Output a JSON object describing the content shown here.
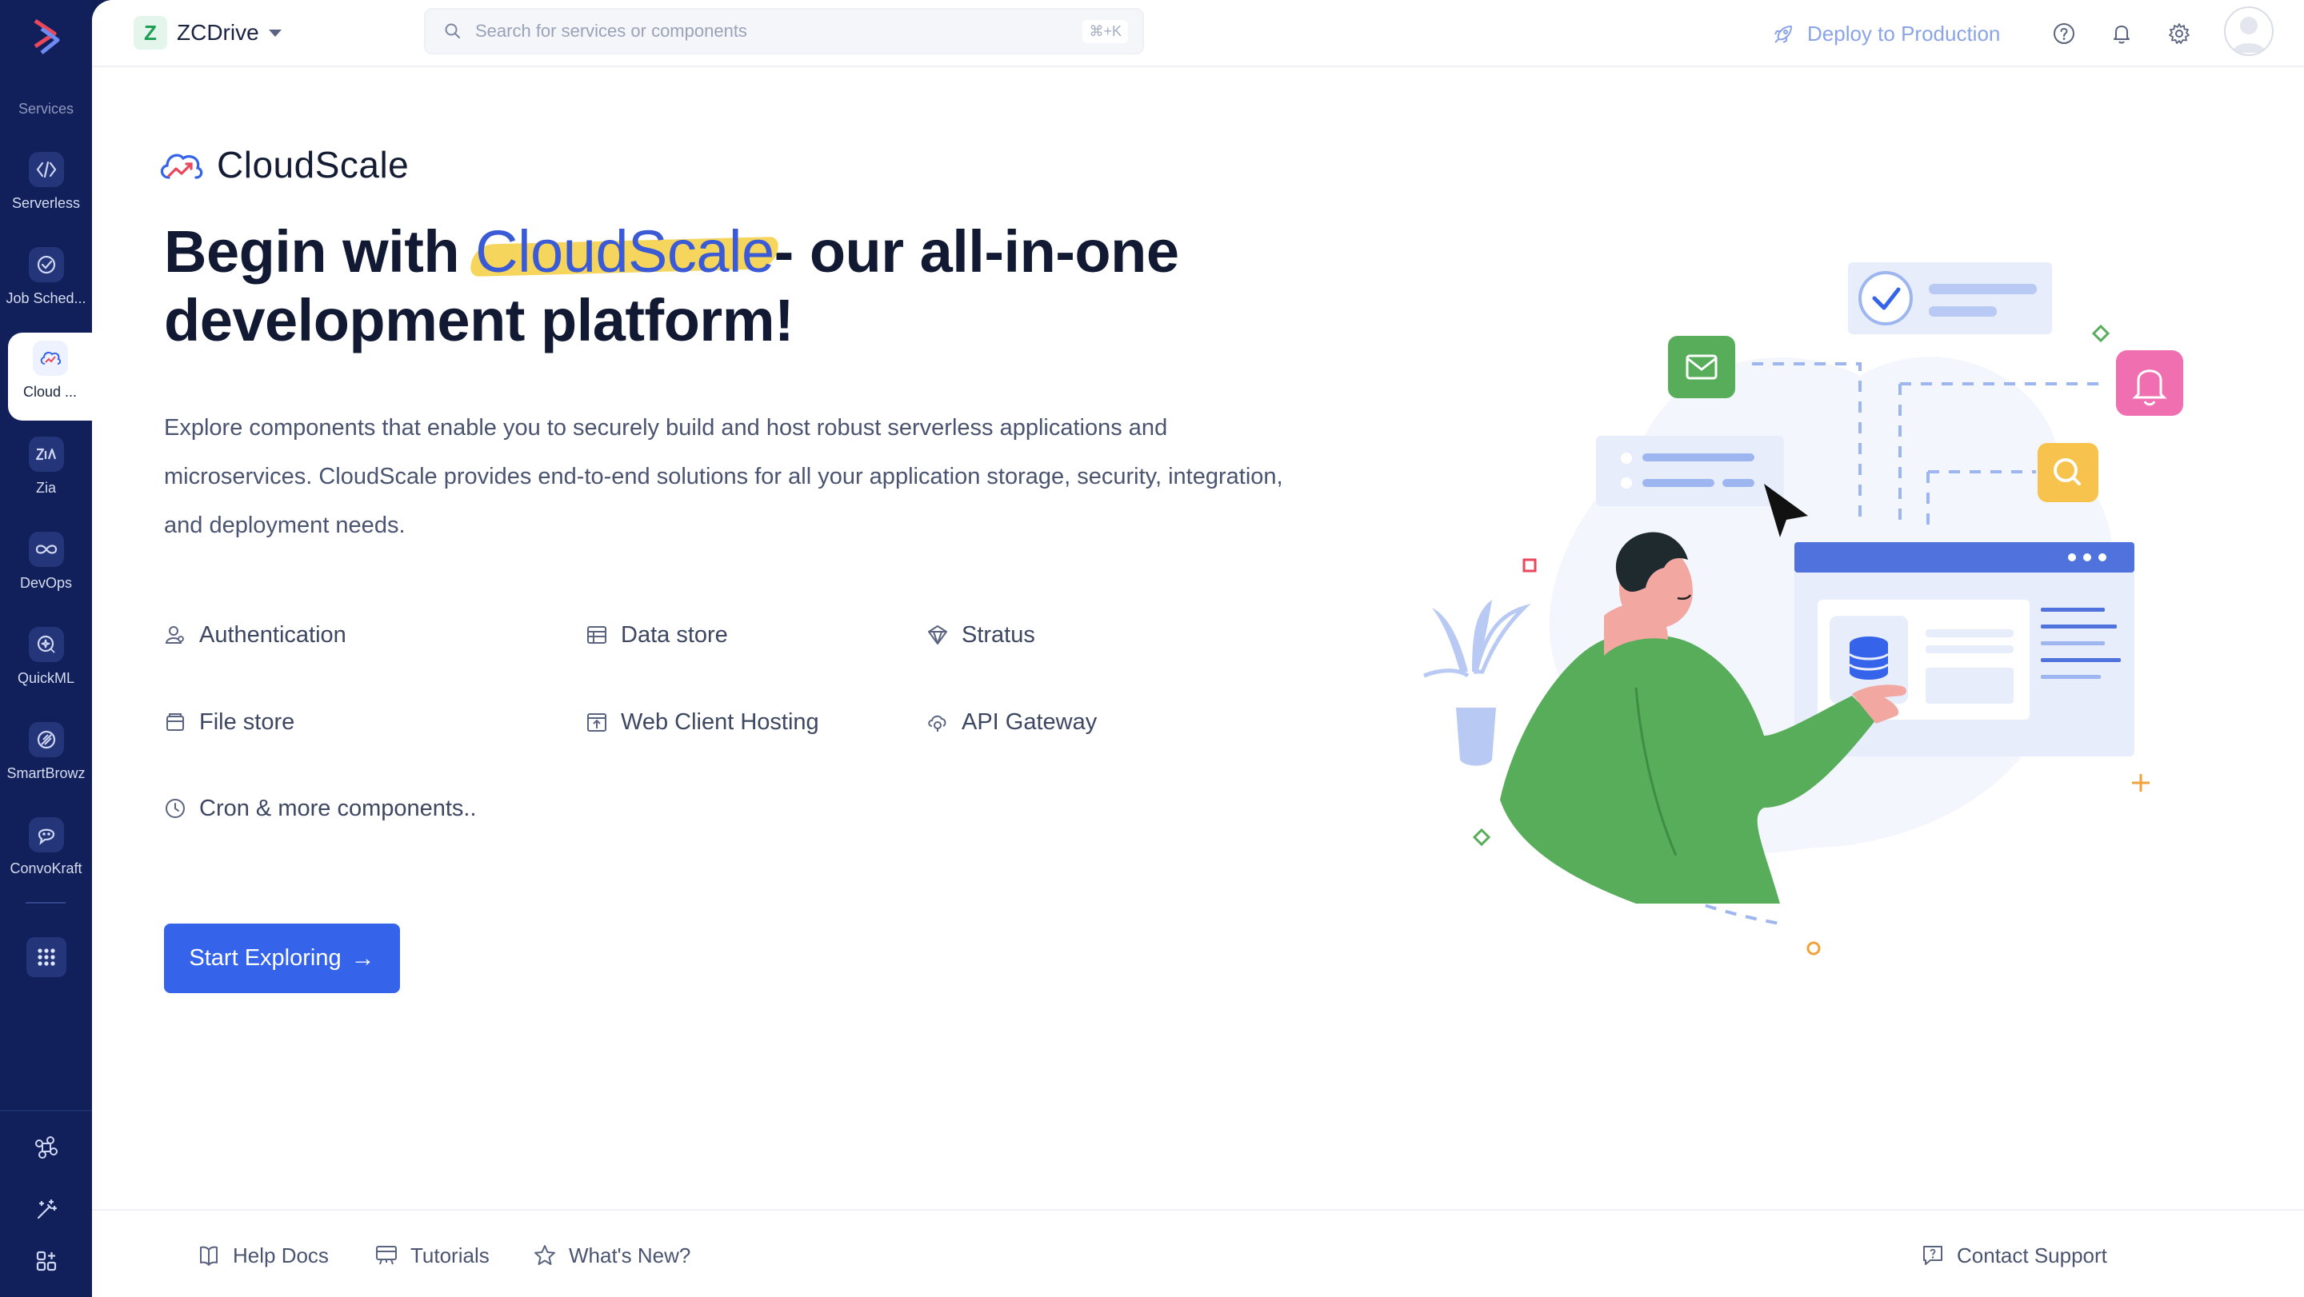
{
  "sidebar": {
    "section_label": "Services",
    "items": [
      {
        "label": "Serverless",
        "icon": "serverless-icon"
      },
      {
        "label": "Job Sched...",
        "icon": "job-scheduler-icon"
      },
      {
        "label": "Cloud ...",
        "icon": "cloudscale-icon",
        "active": true
      },
      {
        "label": "Zia",
        "icon": "zia-icon"
      },
      {
        "label": "DevOps",
        "icon": "devops-icon"
      },
      {
        "label": "QuickML",
        "icon": "quickml-icon"
      },
      {
        "label": "SmartBrowz",
        "icon": "smartbrowz-icon"
      },
      {
        "label": "ConvoKraft",
        "icon": "convokraft-icon"
      }
    ]
  },
  "topbar": {
    "org_initial": "Z",
    "org_name": "ZCDrive",
    "search_placeholder": "Search for services or components",
    "search_shortcut": "⌘+K",
    "deploy_label": "Deploy to Production"
  },
  "hero": {
    "brand": "CloudScale",
    "headline_prefix": "Begin with ",
    "headline_highlight": "CloudScale",
    "headline_suffix": "- our all-in-one development platform!",
    "description": "Explore components that enable you to securely build and host robust serverless applications and microservices. CloudScale provides end-to-end solutions for all your application storage, security, integration, and deployment needs.",
    "components": [
      {
        "label": "Authentication",
        "icon": "user-icon"
      },
      {
        "label": "Data store",
        "icon": "table-icon"
      },
      {
        "label": "Stratus",
        "icon": "stratus-icon"
      },
      {
        "label": "File store",
        "icon": "folder-icon"
      },
      {
        "label": "Web Client Hosting",
        "icon": "upload-icon"
      },
      {
        "label": "API Gateway",
        "icon": "gateway-icon"
      },
      {
        "label": "Cron & more components..",
        "icon": "clock-icon"
      }
    ],
    "cta_label": "Start Exploring"
  },
  "footer": {
    "help_docs": "Help Docs",
    "tutorials": "Tutorials",
    "whats_new": "What's New?",
    "contact_support": "Contact Support"
  },
  "colors": {
    "sidebar_bg": "#11205a",
    "primary": "#3563e9",
    "highlight": "#f6d55c",
    "figure_green": "#58ad5b"
  }
}
